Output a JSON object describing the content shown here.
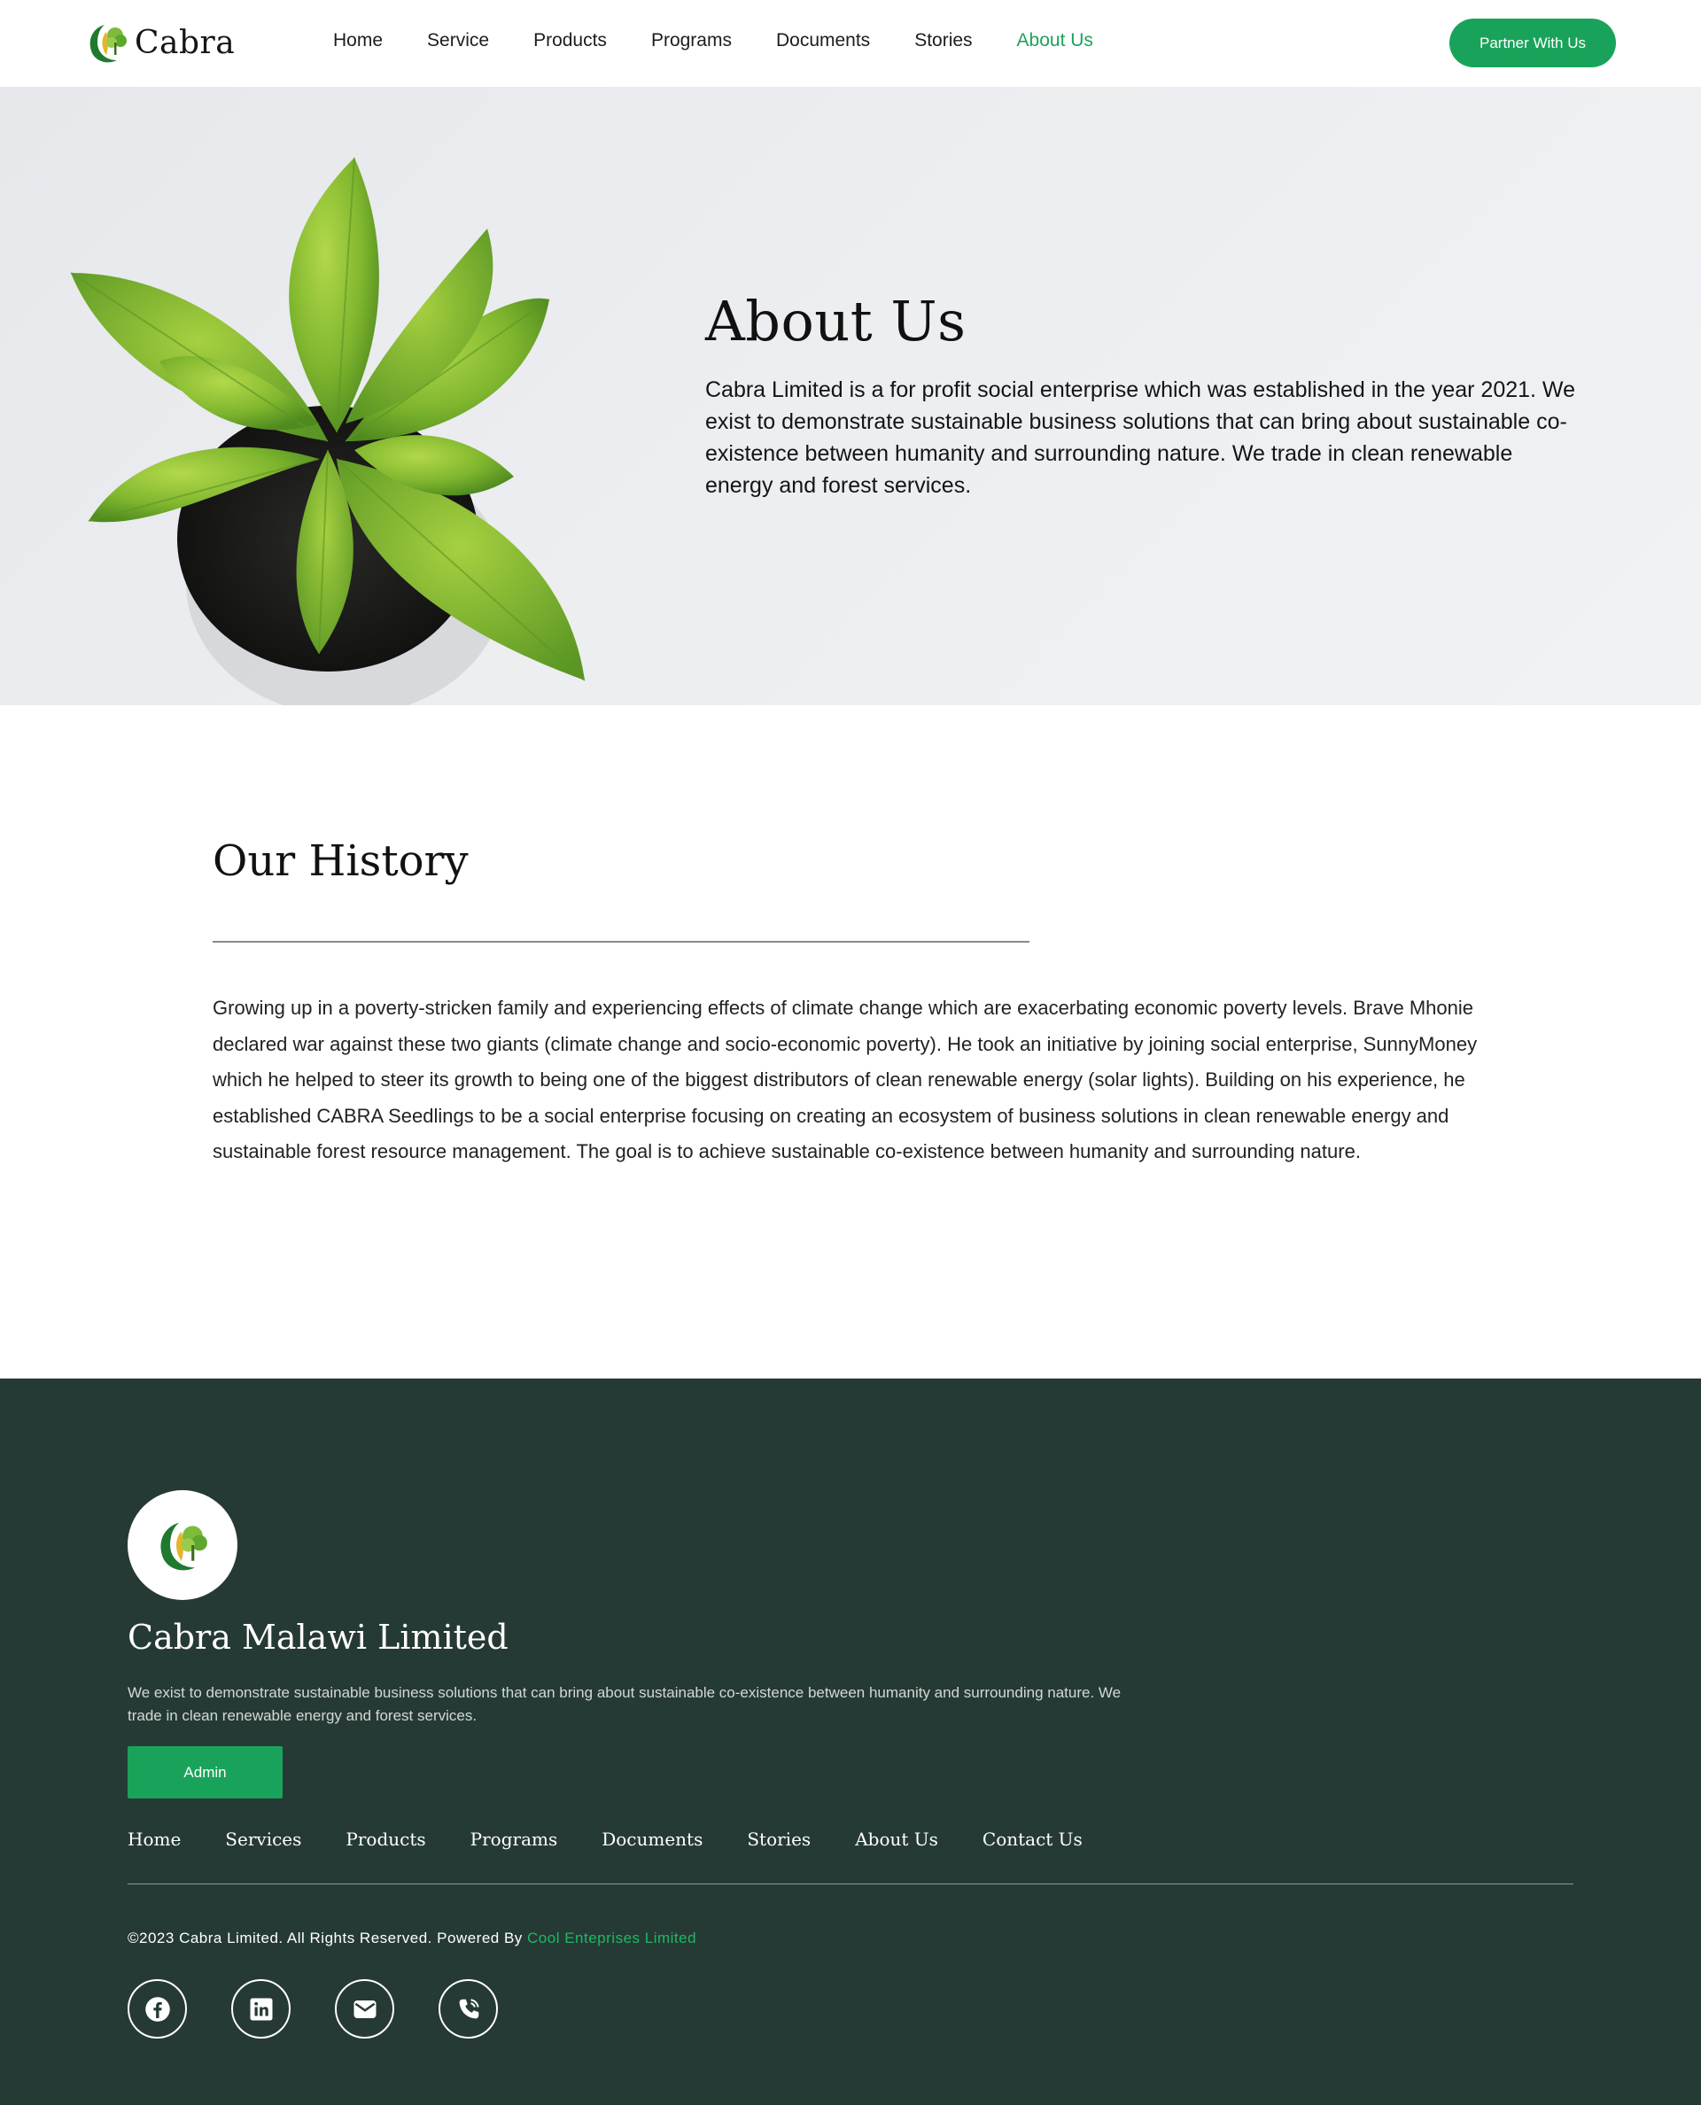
{
  "header": {
    "logo_text": "Cabra",
    "nav": [
      {
        "label": "Home",
        "active": false
      },
      {
        "label": "Service",
        "active": false
      },
      {
        "label": "Products",
        "active": false
      },
      {
        "label": "Programs",
        "active": false
      },
      {
        "label": "Documents",
        "active": false
      },
      {
        "label": "Stories",
        "active": false
      },
      {
        "label": "About Us",
        "active": true
      }
    ],
    "cta_label": "Partner With Us"
  },
  "hero": {
    "title": "About Us",
    "text": "Cabra Limited is a for profit social enterprise which was established in the year 2021. We exist to demonstrate sustainable business solutions that can bring about sustainable co-existence between humanity and surrounding nature. We trade in clean renewable energy and forest services."
  },
  "history": {
    "title": "Our History",
    "text": "Growing up in a poverty-stricken family and experiencing effects of climate change which are exacerbating economic poverty levels. Brave Mhonie declared war against these two giants (climate change and socio-economic poverty). He took an initiative by joining social enterprise, SunnyMoney which he helped to steer its growth to being one of the biggest distributors of clean renewable energy (solar lights). Building on his experience, he established CABRA Seedlings to be a social enterprise focusing on creating an ecosystem of business solutions in clean renewable energy and sustainable forest resource management. The goal is to achieve sustainable co-existence between humanity and surrounding nature."
  },
  "footer": {
    "title": "Cabra Malawi Limited",
    "description": "We exist to demonstrate sustainable business solutions that can bring about sustainable co-existence between humanity and surrounding nature. We trade in clean renewable energy and forest services.",
    "admin_label": "Admin",
    "nav": [
      "Home",
      "Services",
      "Products",
      "Programs",
      "Documents",
      "Stories",
      "About Us",
      "Contact Us"
    ],
    "copyright": "©2023 Cabra Limited. All Rights Reserved. Powered By ",
    "powered_by": "Cool Enteprises Limited",
    "socials": [
      "facebook-icon",
      "linkedin-icon",
      "email-icon",
      "phone-icon"
    ]
  },
  "colors": {
    "accent": "#19a35a",
    "footer_bg": "#263a35",
    "hero_bg": "#e9ebee"
  }
}
